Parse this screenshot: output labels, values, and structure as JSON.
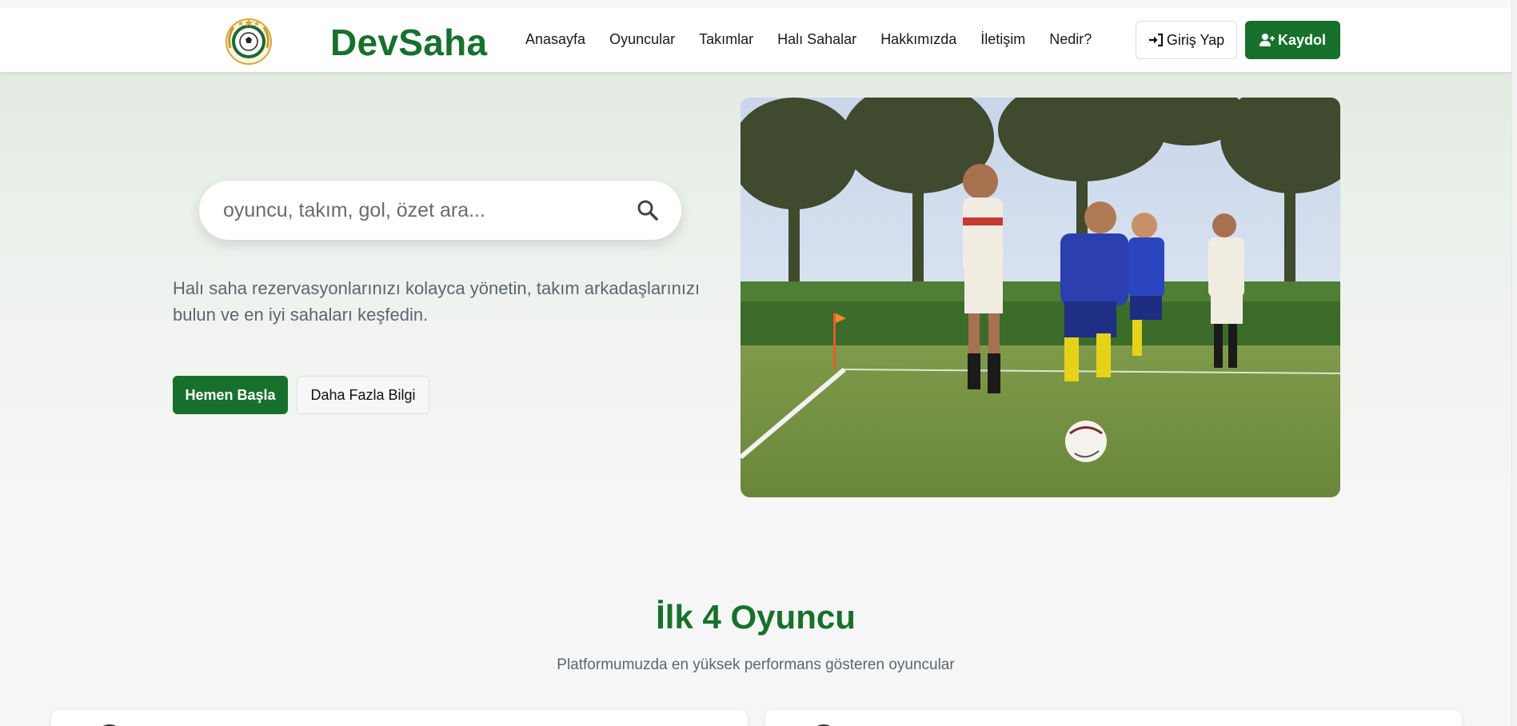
{
  "header": {
    "brand": "DevSaha",
    "nav": [
      {
        "label": "Anasayfa"
      },
      {
        "label": "Oyuncular"
      },
      {
        "label": "Takımlar"
      },
      {
        "label": "Halı Sahalar"
      },
      {
        "label": "Hakkımızda"
      },
      {
        "label": "İletişim"
      },
      {
        "label": "Nedir?"
      }
    ],
    "login_label": "Giriş Yap",
    "register_label": "Kaydol",
    "login_icon": "sign-in-icon",
    "register_icon": "user-plus-icon"
  },
  "hero": {
    "search_placeholder": "oyuncu, takım, gol, özet ara...",
    "search_icon": "search-icon",
    "description": "Halı saha rezervasyonlarınızı kolayca yönetin, takım arkadaşlarınızı bulun ve en iyi sahaları keşfedin.",
    "primary_button": "Hemen Başla",
    "secondary_button": "Daha Fazla Bilgi",
    "image_alt": "football-players-photo"
  },
  "players_section": {
    "title": "İlk 4 Oyuncu",
    "subtitle": "Platformumuzda en yüksek performans gösteren oyuncular"
  },
  "colors": {
    "brand_green": "#17702c",
    "text_muted": "#5c6670"
  }
}
